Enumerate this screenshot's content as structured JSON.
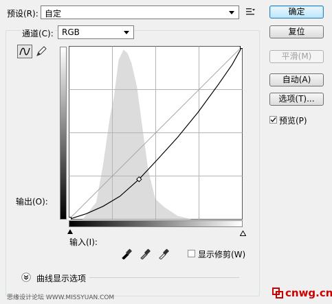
{
  "preset": {
    "label": "预设(R):",
    "value": "自定"
  },
  "channel": {
    "label": "通道(C):",
    "value": "RGB"
  },
  "buttons": {
    "ok": "确定",
    "reset": "复位",
    "smooth": "平滑(M)",
    "auto": "自动(A)",
    "options": "选项(T)..."
  },
  "preview": {
    "label": "预览(P)",
    "checked": true
  },
  "output_label": "输出(O):",
  "input_label": "输入(I):",
  "show_clipping": {
    "label": "显示修剪(W)",
    "checked": false
  },
  "curve_display_options": "曲线显示选项",
  "watermark_left": "思缘设计论坛 WWW.MISSYUAN.COM",
  "watermark_right": "cnwg.cn",
  "icons": [
    "preset-menu-icon",
    "curve-tool-icon",
    "pencil-tool-icon",
    "black-eyedropper-icon",
    "gray-eyedropper-icon",
    "white-eyedropper-icon",
    "expand-icon",
    "logo-icon"
  ],
  "colors": {
    "accent": "#3c7fb1",
    "watermark_red": "#cc0000",
    "histogram": "#dcdcdc"
  },
  "curve": {
    "control_points": [
      [
        0,
        0
      ],
      [
        103,
        59
      ],
      [
        255,
        255
      ]
    ],
    "curve_points": [
      [
        0,
        0
      ],
      [
        25,
        8
      ],
      [
        50,
        19
      ],
      [
        75,
        34
      ],
      [
        103,
        59
      ],
      [
        130,
        88
      ],
      [
        160,
        121
      ],
      [
        190,
        158
      ],
      [
        220,
        199
      ],
      [
        240,
        228
      ],
      [
        255,
        255
      ]
    ],
    "histogram": [
      [
        0,
        0
      ],
      [
        20,
        0
      ],
      [
        40,
        25
      ],
      [
        50,
        80
      ],
      [
        60,
        150
      ],
      [
        66,
        180
      ],
      [
        73,
        235
      ],
      [
        80,
        250
      ],
      [
        86,
        245
      ],
      [
        92,
        230
      ],
      [
        100,
        195
      ],
      [
        110,
        120
      ],
      [
        117,
        70
      ],
      [
        127,
        30
      ],
      [
        140,
        18
      ],
      [
        160,
        5
      ],
      [
        180,
        0
      ],
      [
        255,
        0
      ]
    ],
    "grid_divisions": 4
  }
}
